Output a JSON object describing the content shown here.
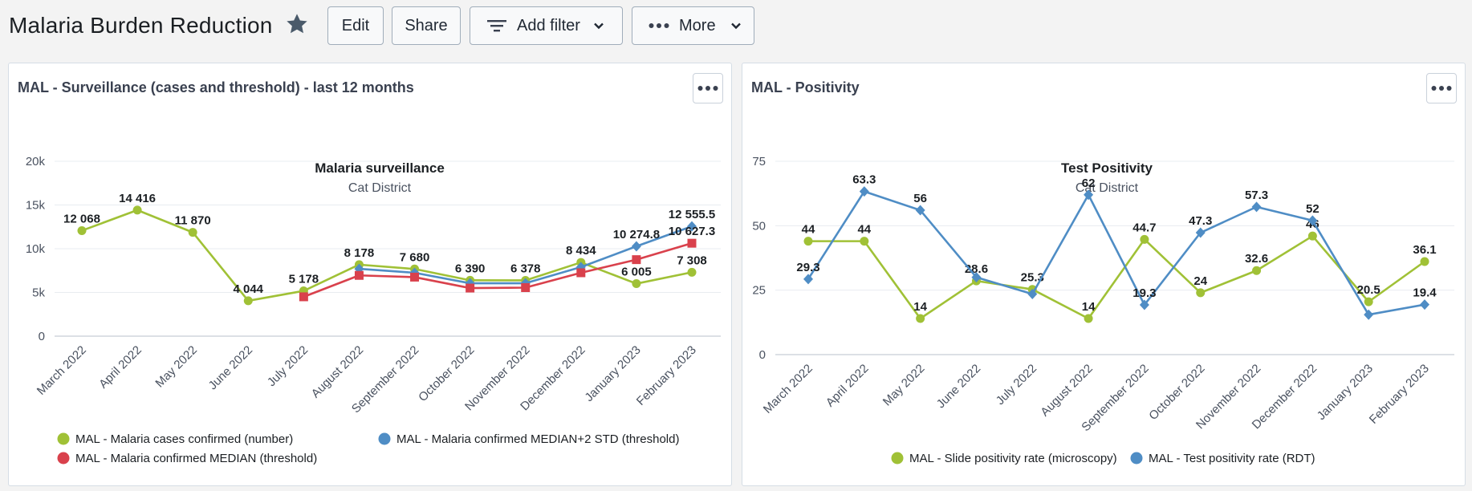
{
  "dashboard": {
    "title": "Malaria Burden Reduction",
    "buttons": {
      "edit": "Edit",
      "share": "Share",
      "add_filter": "Add filter",
      "more": "More"
    }
  },
  "panels": [
    {
      "title": "MAL - Surveillance (cases and threshold) - last 12 months"
    },
    {
      "title": "MAL - Positivity"
    }
  ],
  "chart_data": [
    {
      "type": "line",
      "title": "Malaria surveillance",
      "subtitle": "Cat District",
      "categories": [
        "March 2022",
        "April 2022",
        "May 2022",
        "June 2022",
        "July 2022",
        "August 2022",
        "September 2022",
        "October 2022",
        "November 2022",
        "December 2022",
        "January 2023",
        "February 2023"
      ],
      "yticks": [
        "0",
        "5k",
        "10k",
        "15k",
        "20k"
      ],
      "ylim": [
        0,
        20000
      ],
      "grid": true,
      "legend_position": "bottom",
      "series": [
        {
          "name": "MAL - Malaria cases confirmed (number)",
          "color": "#a0c136",
          "marker": "circle",
          "values": [
            12068,
            14416,
            11870,
            4044,
            5178,
            8178,
            7680,
            6390,
            6378,
            8434,
            6005,
            7308
          ],
          "labels": [
            "12 068",
            "14 416",
            "11 870",
            "4 044",
            "5 178",
            "8 178",
            "7 680",
            "6 390",
            "6 378",
            "8 434",
            "6 005",
            "7 308"
          ]
        },
        {
          "name": "MAL - Malaria confirmed MEDIAN+2 STD (threshold)",
          "color": "#4f8dc5",
          "marker": "diamond",
          "values": [
            null,
            null,
            null,
            null,
            null,
            7700,
            7250,
            6050,
            6050,
            7900,
            10274.8,
            12555.5
          ],
          "labels": [
            "",
            "",
            "",
            "",
            "",
            "",
            "",
            "",
            "",
            "",
            "10 274.8",
            "12 555.5"
          ]
        },
        {
          "name": "MAL - Malaria confirmed MEDIAN (threshold)",
          "color": "#d9414c",
          "marker": "square",
          "values": [
            null,
            null,
            null,
            null,
            4500,
            6950,
            6750,
            5500,
            5550,
            7250,
            8750,
            10627.3
          ],
          "labels": [
            "",
            "",
            "",
            "",
            "",
            "",
            "",
            "",
            "",
            "",
            "",
            "10 627.3"
          ]
        }
      ]
    },
    {
      "type": "line",
      "title": "Test Positivity",
      "subtitle": "Cat District",
      "categories": [
        "March 2022",
        "April 2022",
        "May 2022",
        "June 2022",
        "July 2022",
        "August 2022",
        "September 2022",
        "October 2022",
        "November 2022",
        "December 2022",
        "January 2023",
        "February 2023"
      ],
      "yticks": [
        "0",
        "25",
        "50",
        "75"
      ],
      "ylim": [
        0,
        75
      ],
      "grid": true,
      "legend_position": "bottom",
      "series": [
        {
          "name": "MAL - Slide positivity rate (microscopy)",
          "color": "#a0c136",
          "marker": "circle",
          "values": [
            44,
            44,
            14,
            28.6,
            25.3,
            14,
            44.7,
            24,
            32.6,
            46,
            20.5,
            36.1
          ],
          "labels": [
            "44",
            "44",
            "14",
            "28.6",
            "25.3",
            "14",
            "44.7",
            "24",
            "32.6",
            "46",
            "20.5",
            "36.1"
          ]
        },
        {
          "name": "MAL - Test positivity rate (RDT)",
          "color": "#4f8dc5",
          "marker": "diamond",
          "values": [
            29.3,
            63.3,
            56,
            30,
            23.5,
            62,
            19.3,
            47.3,
            57.3,
            52,
            15.5,
            19.4
          ],
          "labels": [
            "29.3",
            "63.3",
            "56",
            "",
            "",
            "62",
            "19.3",
            "47.3",
            "57.3",
            "52",
            "",
            "19.4"
          ]
        }
      ]
    }
  ]
}
